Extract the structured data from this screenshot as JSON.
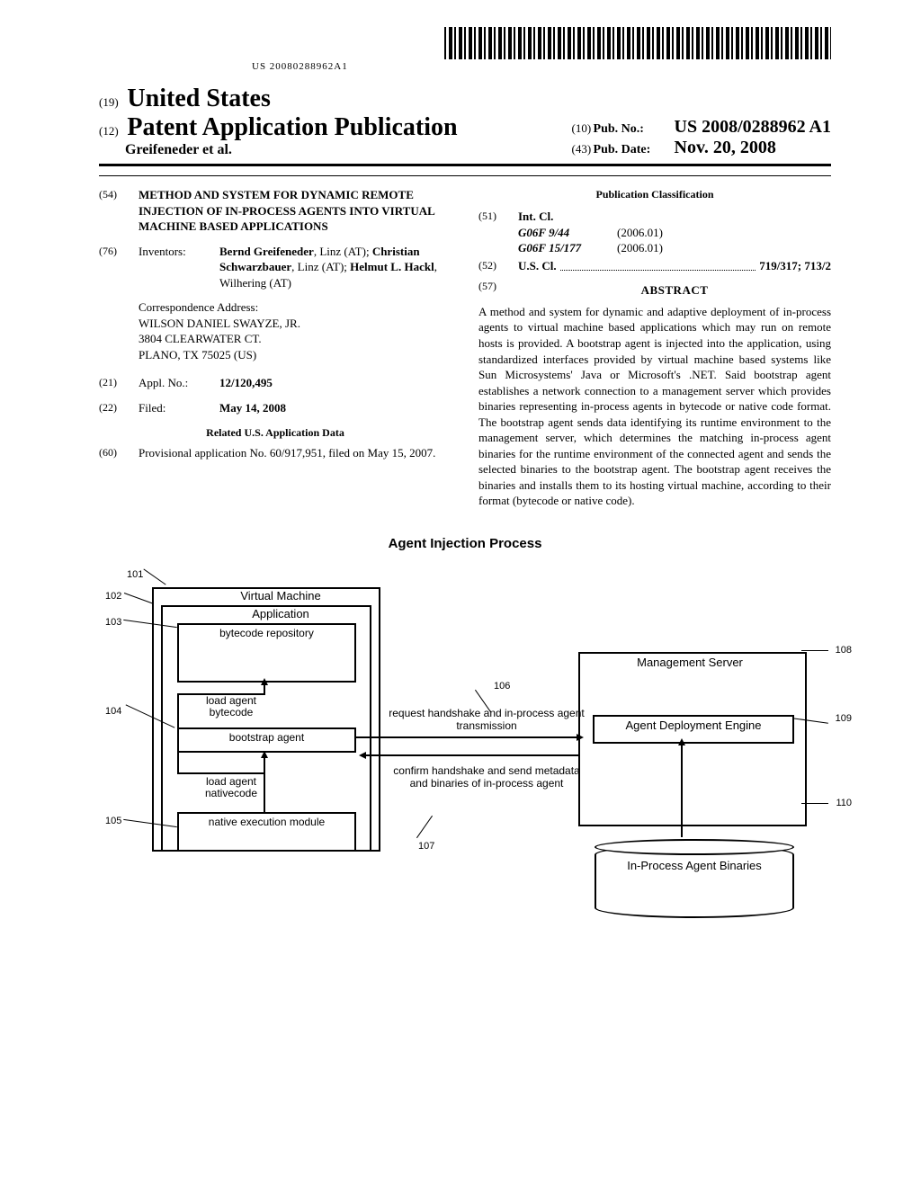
{
  "barcode_number": "US 20080288962A1",
  "header": {
    "code19": "(19)",
    "country": "United States",
    "code12": "(12)",
    "pub_label": "Patent Application Publication",
    "authors_line": "Greifeneder et al.",
    "code10": "(10)",
    "pubno_label": "Pub. No.:",
    "pubno": "US 2008/0288962 A1",
    "code43": "(43)",
    "pubdate_label": "Pub. Date:",
    "pubdate": "Nov. 20, 2008"
  },
  "left_col": {
    "code54": "(54)",
    "title": "METHOD AND SYSTEM FOR DYNAMIC REMOTE INJECTION OF IN-PROCESS AGENTS INTO VIRTUAL MACHINE BASED APPLICATIONS",
    "code76": "(76)",
    "inventors_label": "Inventors:",
    "inventors_html": "Bernd Greifeneder, Linz (AT); Christian Schwarzbauer, Linz (AT); Helmut L. Hackl, Wilhering (AT)",
    "inv1": "Bernd Greifeneder",
    "inv1_rest": ", Linz (AT); ",
    "inv2": "Christian Schwarzbauer",
    "inv2_rest": ", Linz (AT); ",
    "inv3": "Helmut L. Hackl",
    "inv3_rest": ", Wilhering (AT)",
    "corr_label": "Correspondence Address:",
    "corr_name": "WILSON DANIEL SWAYZE, JR.",
    "corr_addr1": "3804 CLEARWATER CT.",
    "corr_addr2": "PLANO, TX 75025 (US)",
    "code21": "(21)",
    "appl_label": "Appl. No.:",
    "appl_no": "12/120,495",
    "code22": "(22)",
    "filed_label": "Filed:",
    "filed_date": "May 14, 2008",
    "related_head": "Related U.S. Application Data",
    "code60": "(60)",
    "related_text": "Provisional application No. 60/917,951, filed on May 15, 2007."
  },
  "right_col": {
    "pub_class_head": "Publication Classification",
    "code51": "(51)",
    "intcl_label": "Int. Cl.",
    "intcl_1_code": "G06F 9/44",
    "intcl_1_year": "(2006.01)",
    "intcl_2_code": "G06F 15/177",
    "intcl_2_year": "(2006.01)",
    "code52": "(52)",
    "uscl_label": "U.S. Cl.",
    "uscl_val": "719/317; 713/2",
    "code57": "(57)",
    "abstract_head": "ABSTRACT",
    "abstract": "A method and system for dynamic and adaptive deployment of in-process agents to virtual machine based applications which may run on remote hosts is provided. A bootstrap agent is injected into the application, using standardized interfaces provided by virtual machine based systems like Sun Microsystems' Java or Microsoft's .NET. Said bootstrap agent establishes a network connection to a management server which provides binaries representing in-process agents in bytecode or native code format. The bootstrap agent sends data identifying its runtime environment to the management server, which determines the matching in-process agent binaries for the runtime environment of the connected agent and sends the selected binaries to the bootstrap agent. The bootstrap agent receives the binaries and installs them to its hosting virtual machine, according to their format (bytecode or native code)."
  },
  "figure": {
    "title": "Agent Injection Process",
    "vm": "Virtual Machine",
    "app": "Application",
    "repo": "bytecode repository",
    "load_byte": "load agent bytecode",
    "bootstrap": "bootstrap agent",
    "load_native": "load agent nativecode",
    "native_mod": "native execution module",
    "mgmt": "Management Server",
    "engine": "Agent Deployment Engine",
    "db": "In-Process Agent Binaries",
    "req": "request handshake and in-process agent transmission",
    "conf": "confirm handshake and send metadata and binaries of in-process agent",
    "n101": "101",
    "n102": "102",
    "n103": "103",
    "n104": "104",
    "n105": "105",
    "n106": "106",
    "n107": "107",
    "n108": "108",
    "n109": "109",
    "n110": "110"
  }
}
